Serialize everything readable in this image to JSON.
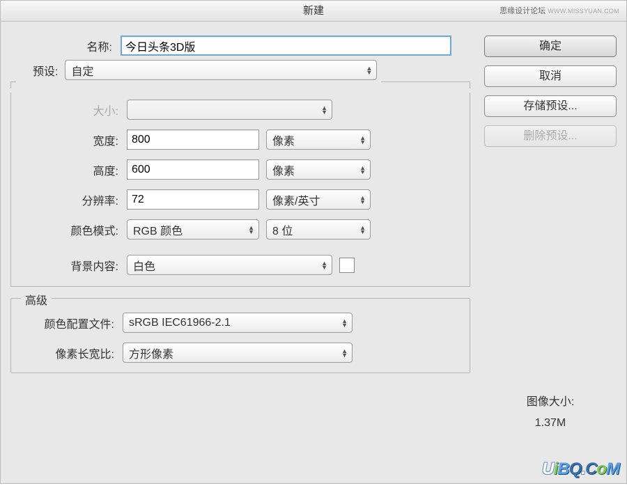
{
  "dialog": {
    "title": "新建"
  },
  "watermark_top": {
    "cn": "思缘设计论坛",
    "url": "WWW.MISSYUAN.COM"
  },
  "labels": {
    "name": "名称:",
    "preset": "预设:",
    "size": "大小:",
    "width": "宽度:",
    "height": "高度:",
    "resolution": "分辨率:",
    "color_mode": "颜色模式:",
    "background": "背景内容:",
    "advanced": "高级",
    "color_profile": "颜色配置文件:",
    "pixel_ratio": "像素长宽比:"
  },
  "values": {
    "name": "今日头条3D版",
    "preset": "自定",
    "size": "",
    "width": "800",
    "height": "600",
    "resolution": "72",
    "color_mode": "RGB 颜色",
    "color_depth": "8 位",
    "background": "白色",
    "color_profile": "sRGB IEC61966-2.1",
    "pixel_ratio": "方形像素"
  },
  "units": {
    "width": "像素",
    "height": "像素",
    "resolution": "像素/英寸"
  },
  "buttons": {
    "ok": "确定",
    "cancel": "取消",
    "save_preset": "存储预设...",
    "delete_preset": "删除预设..."
  },
  "info": {
    "image_size_label": "图像大小:",
    "image_size_value": "1.37M"
  },
  "logo_br": "UiBQ.CoM"
}
